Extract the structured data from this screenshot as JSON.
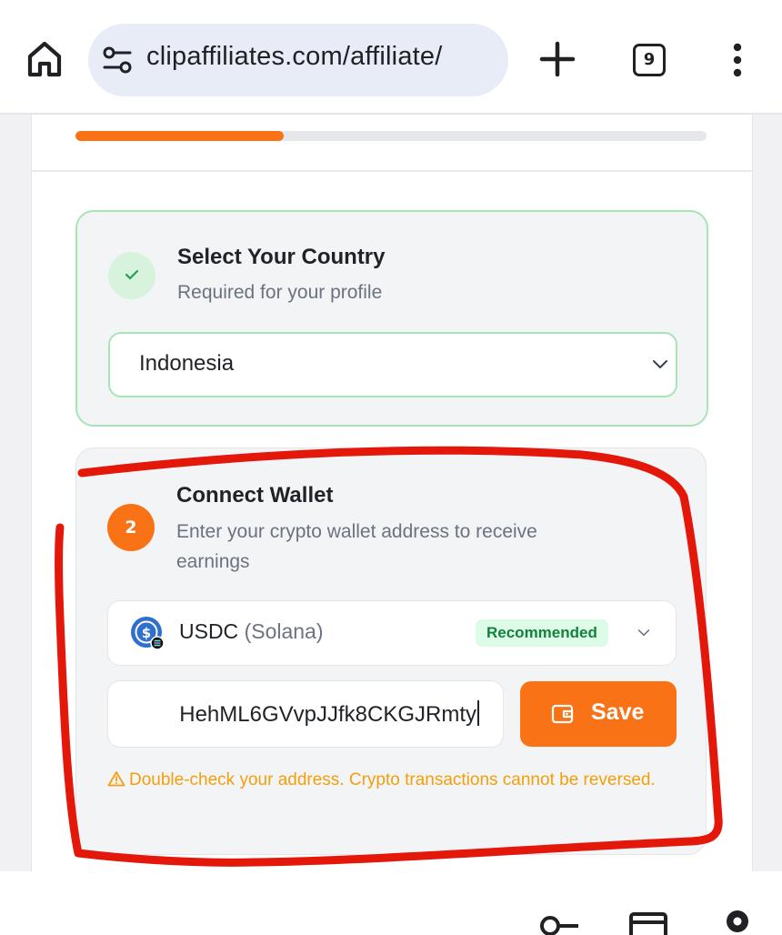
{
  "browser": {
    "url": "clipaffiliates.com/affiliate/",
    "tab_count": "9"
  },
  "progress": {
    "percent": 33
  },
  "step_country": {
    "title": "Select Your Country",
    "subtitle": "Required for your profile",
    "selected_country": "Indonesia"
  },
  "step_wallet": {
    "number": "2",
    "title": "Connect Wallet",
    "subtitle_line1": "Enter your crypto wallet address to receive",
    "subtitle_line2": "earnings",
    "token": "USDC",
    "network": "(Solana)",
    "badge": "Recommended",
    "address_value": "HehML6GVvpJJfk8CKGJRmty",
    "save_label": "Save",
    "warning": "Double-check your address. Crypto transactions cannot be reversed."
  },
  "colors": {
    "accent": "#f97316",
    "success": "#16a34a",
    "annotation": "#e3170a",
    "warning": "#f59e0b"
  },
  "icons": [
    "home-icon",
    "tune-icon",
    "plus-icon",
    "more-vert-icon",
    "check-icon",
    "chevron-down-icon",
    "usdc-icon",
    "wallet-icon",
    "warning-icon",
    "key-icon",
    "card-icon",
    "location-icon"
  ]
}
